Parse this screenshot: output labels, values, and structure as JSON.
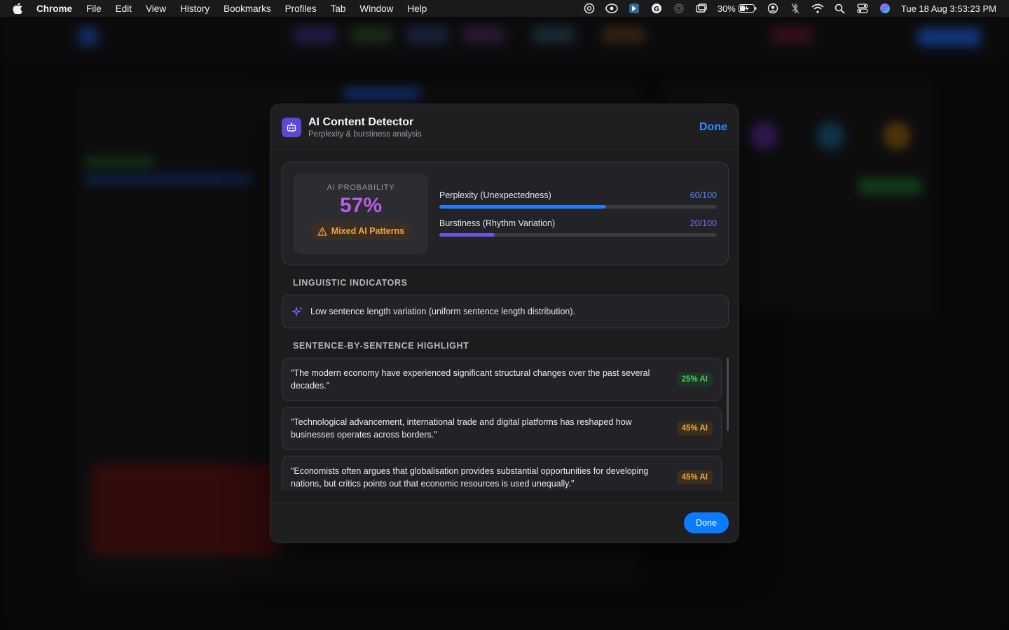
{
  "menubar": {
    "app": "Chrome",
    "items": [
      "File",
      "Edit",
      "View",
      "History",
      "Bookmarks",
      "Profiles",
      "Tab",
      "Window",
      "Help"
    ],
    "battery": "30%",
    "datetime": "Tue 18 Aug  3:53:23 PM"
  },
  "modal": {
    "title": "AI Content Detector",
    "subtitle": "Perplexity & burstiness analysis",
    "done_link": "Done",
    "score": {
      "label": "AI PROBABILITY",
      "value": "57%",
      "badge": "Mixed AI Patterns",
      "badge_color": "#f0a445",
      "value_color": "#b65ee8"
    },
    "metrics": [
      {
        "name": "Perplexity (Unexpectedness)",
        "score": "60/100",
        "fraction": 0.6,
        "color": "#1f7bff"
      },
      {
        "name": "Burstiness (Rhythm Variation)",
        "score": "20/100",
        "fraction": 0.2,
        "color": "#6a55e8"
      }
    ],
    "linguistic_title": "LINGUISTIC INDICATORS",
    "indicator_text": "Low sentence length variation (uniform sentence length distribution).",
    "sentence_title": "SENTENCE-BY-SENTENCE HIGHLIGHT",
    "sentences": [
      {
        "text": "\"The modern economy have experienced significant structural changes over the past several decades.\"",
        "badge": "25% AI",
        "level": "green"
      },
      {
        "text": "\"Technological advancement, international trade and digital platforms has reshaped how businesses operates across borders.\"",
        "badge": "45% AI",
        "level": "orange"
      },
      {
        "text": "\"Economists often argues that globalisation provides substantial opportunities for developing nations, but critics points out that economic resources is used unequally.\"",
        "badge": "45% AI",
        "level": "orange"
      }
    ],
    "footer_done": "Done"
  }
}
